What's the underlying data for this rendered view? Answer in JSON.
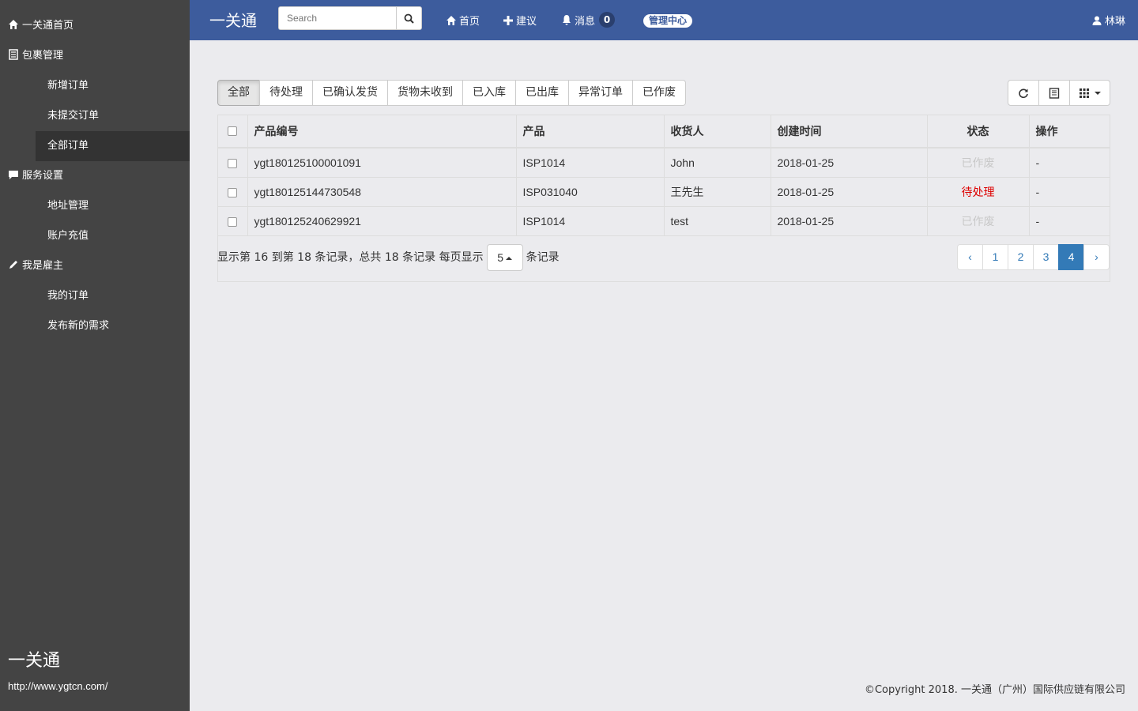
{
  "sidebar": {
    "items": [
      {
        "label": "一关通首页",
        "icon": "home-icon",
        "level": "top"
      },
      {
        "label": "包裹管理",
        "icon": "list-icon",
        "level": "top"
      },
      {
        "label": "新增订单",
        "level": "sub"
      },
      {
        "label": "未提交订单",
        "level": "sub"
      },
      {
        "label": "全部订单",
        "level": "sub",
        "active": true
      },
      {
        "label": "服务设置",
        "icon": "comment-icon",
        "level": "top"
      },
      {
        "label": "地址管理",
        "level": "sub"
      },
      {
        "label": "账户充值",
        "level": "sub"
      },
      {
        "label": "我是雇主",
        "icon": "pencil-icon",
        "level": "top"
      },
      {
        "label": "我的订单",
        "level": "sub"
      },
      {
        "label": "发布新的需求",
        "level": "sub"
      }
    ],
    "brand": "一关通",
    "url": "http://www.ygtcn.com/"
  },
  "topbar": {
    "brand": "一关通",
    "search_placeholder": "Search",
    "nav": {
      "home": "首页",
      "suggest": "建议",
      "messages": "消息",
      "message_count": "0",
      "admin": "管理中心"
    },
    "user": "林琳",
    "bg_color": "#3d5c9d"
  },
  "filters": [
    "全部",
    "待处理",
    "已确认发货",
    "货物未收到",
    "已入库",
    "已出库",
    "异常订单",
    "已作废"
  ],
  "table": {
    "columns": [
      "产品编号",
      "产品",
      "收货人",
      "创建时间",
      "状态",
      "操作"
    ],
    "rows": [
      {
        "code": "ygt180125100001091",
        "product": "ISP1014",
        "receiver": "John",
        "created": "2018-01-25",
        "status": "已作废",
        "status_type": "void",
        "action": "-"
      },
      {
        "code": "ygt180125144730548",
        "product": "ISP031040",
        "receiver": "王先生",
        "created": "2018-01-25",
        "status": "待处理",
        "status_type": "pending",
        "action": "-"
      },
      {
        "code": "ygt180125240629921",
        "product": "ISP1014",
        "receiver": "test",
        "created": "2018-01-25",
        "status": "已作废",
        "status_type": "void",
        "action": "-"
      }
    ]
  },
  "pager": {
    "info_prefix": "显示第 16 到第 18 条记录，总共 18 条记录 每页显示",
    "page_size": "5",
    "info_suffix": "条记录",
    "prev": "‹",
    "pages": [
      "1",
      "2",
      "3",
      "4"
    ],
    "current": "4",
    "next": "›"
  },
  "footer": "©Copyright 2018. 一关通（广州）国际供应链有限公司"
}
